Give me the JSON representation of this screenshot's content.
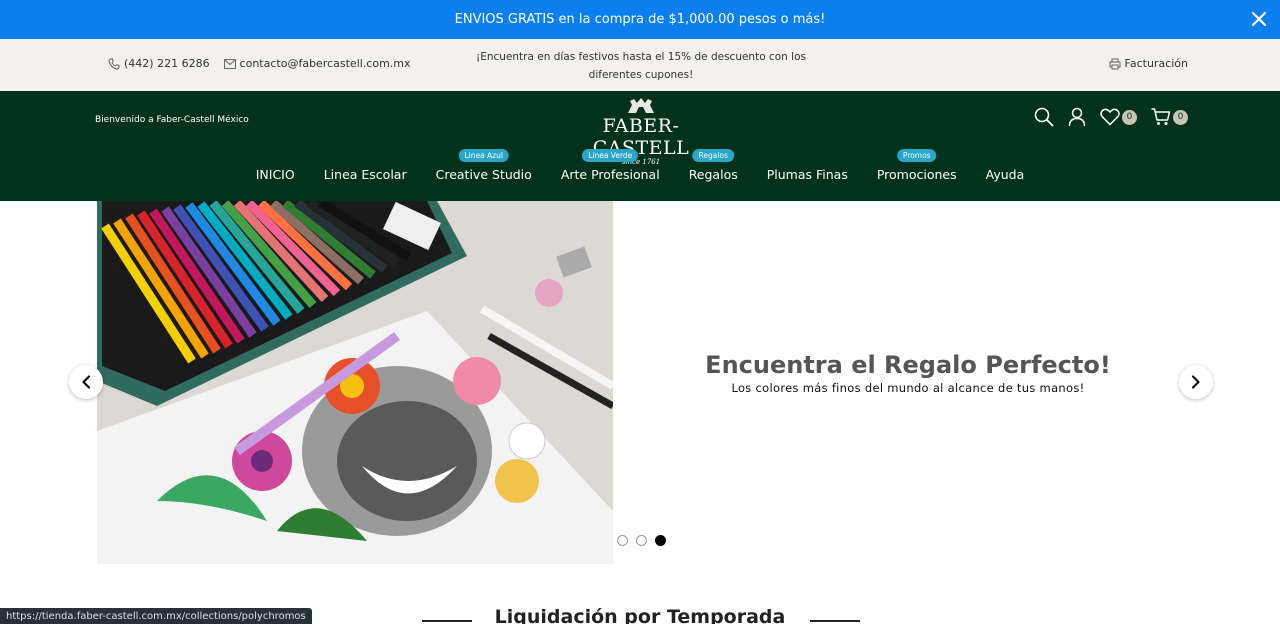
{
  "announcement": {
    "text": "ENVIOS GRATIS en la compra de $1,000.00 pesos o más!"
  },
  "topbar": {
    "phone": "(442) 221 6286",
    "email": "contacto@fabercastell.com.mx",
    "promo": "¡Encuentra en días festivos hasta el 15% de descuento con los diferentes cupones!",
    "billing": "Facturación"
  },
  "header": {
    "welcome": "Bienvenido a Faber-Castell México",
    "logo_text": "FABER-CASTELL",
    "logo_since": "since 1761",
    "wishlist_count": "0",
    "cart_count": "0"
  },
  "nav": {
    "items": [
      {
        "label": "INICIO",
        "tag": ""
      },
      {
        "label": "Linea Escolar",
        "tag": ""
      },
      {
        "label": "Creative Studio",
        "tag": "Linea Azul"
      },
      {
        "label": "Arte Profesional",
        "tag": "Linea Verde"
      },
      {
        "label": "Regalos",
        "tag": "Regalos"
      },
      {
        "label": "Plumas Finas",
        "tag": ""
      },
      {
        "label": "Promociones",
        "tag": "Promos"
      },
      {
        "label": "Ayuda",
        "tag": ""
      }
    ]
  },
  "hero": {
    "headline": "Encuentra el Regalo Perfecto!",
    "subtext": "Los colores más finos del mundo al alcance de tus manos!",
    "active_slide": 3,
    "slide_count": 3
  },
  "section": {
    "title": "Liquidación por Temporada"
  },
  "status_url": "https://tienda.faber-castell.com.mx/collections/polychromos",
  "colors": {
    "announce_bg": "#0b7ff0",
    "header_bg": "#03321c",
    "tag_bg": "#2aa6c9"
  }
}
